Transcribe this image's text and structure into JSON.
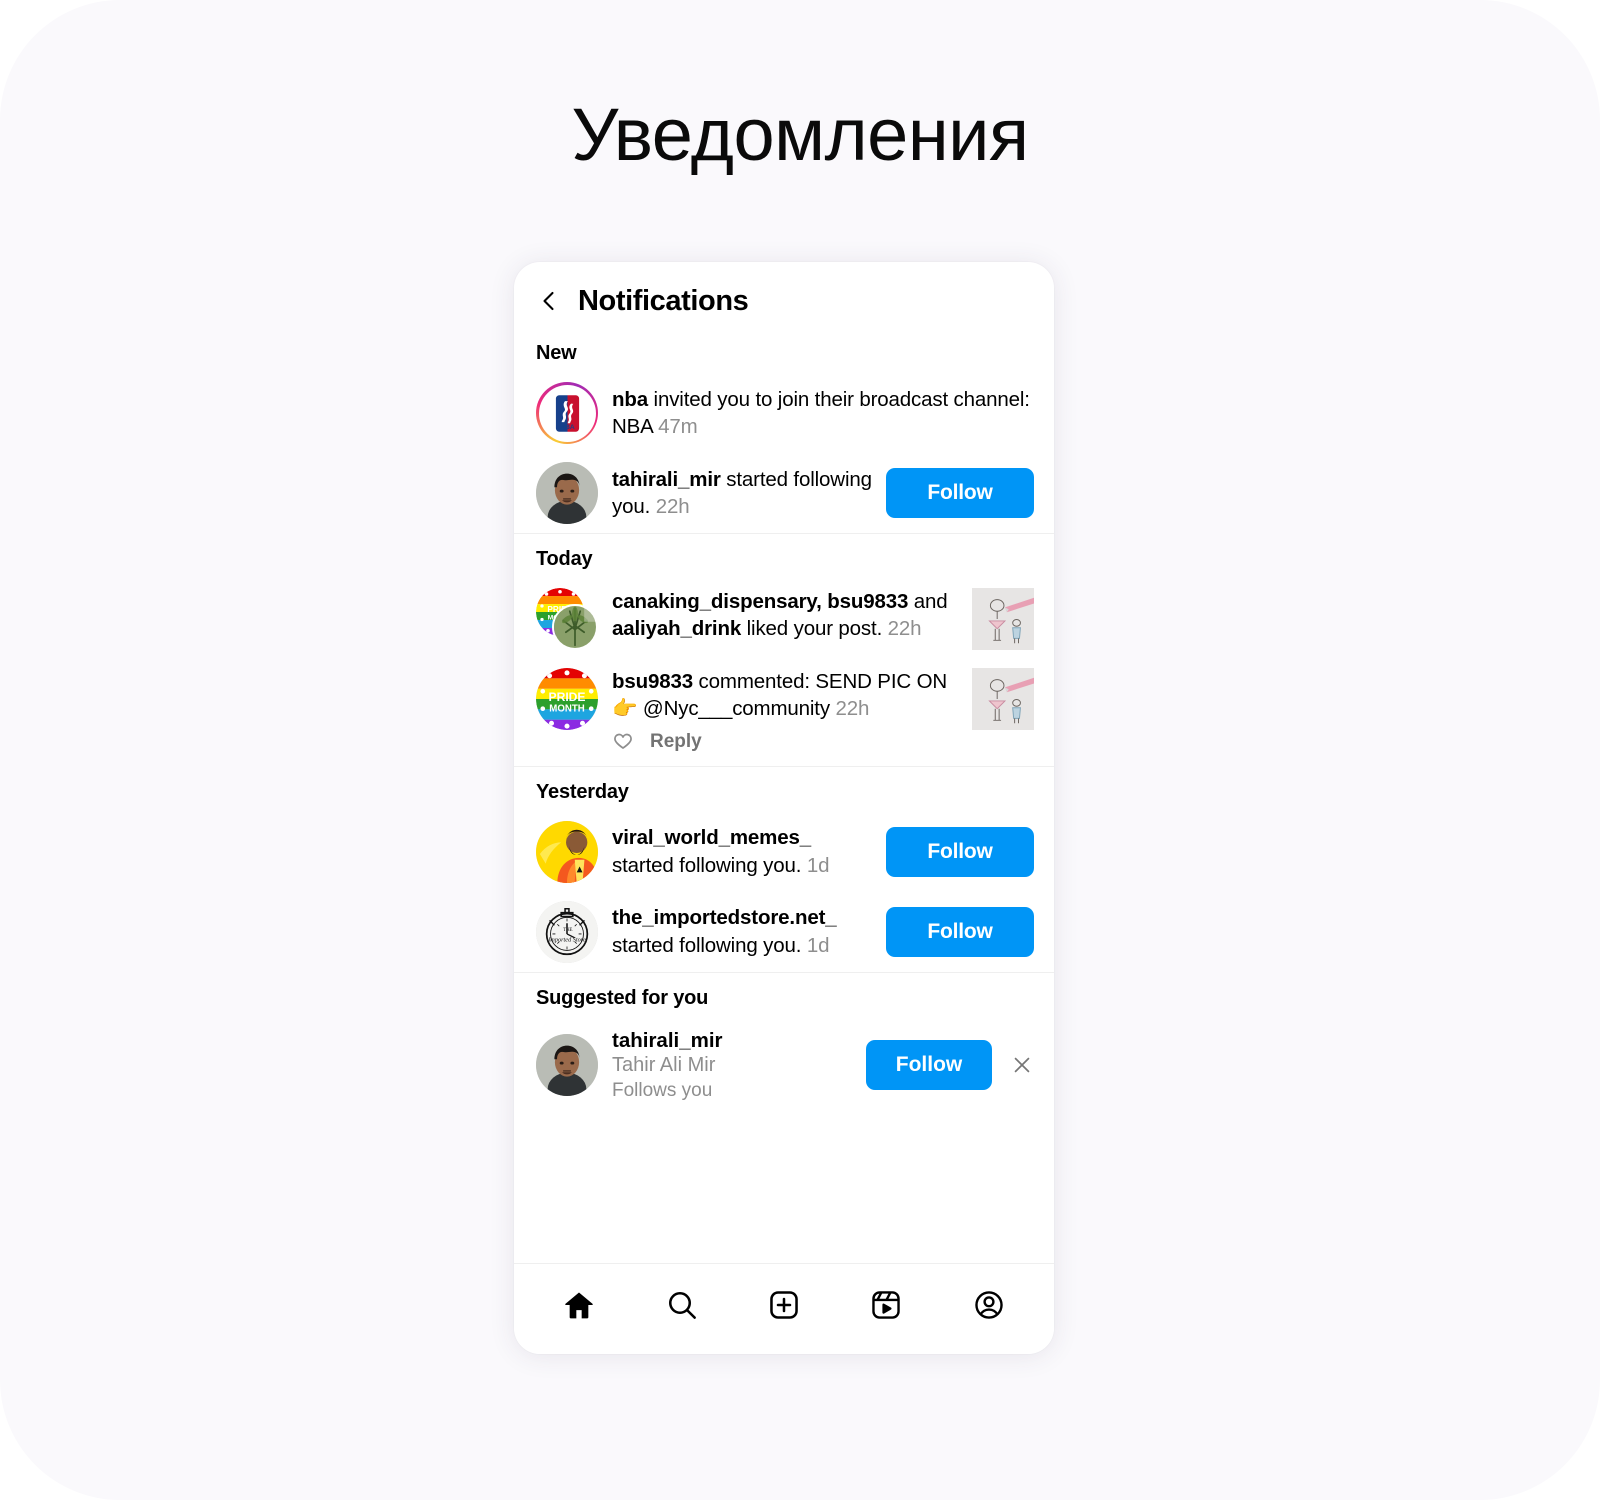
{
  "page": {
    "title": "Уведомления",
    "background_color": "#faf9fc"
  },
  "phone": {
    "header": {
      "back_icon": "chevron-left-icon",
      "title": "Notifications"
    },
    "sections": [
      {
        "id": "new",
        "title": "New",
        "items": [
          {
            "type": "broadcast-invite",
            "avatar": "nba-logo-avatar",
            "has_story_ring": true,
            "actor": "nba",
            "text": " invited you to join their broadcast channel: NBA ",
            "time": "47m"
          },
          {
            "type": "follow-request",
            "avatar": "tahirali-photo-avatar",
            "actor": "tahirali_mir",
            "text": " started following you. ",
            "time": "22h",
            "action_label": "Follow"
          }
        ]
      },
      {
        "id": "today",
        "title": "Today",
        "items": [
          {
            "type": "like",
            "avatar": "pride-plant-stacked-avatar",
            "actor": "canaking_dispensary, bsu9833",
            "text_mid": " and ",
            "actor2": "aaliyah_drink",
            "text": " liked your post. ",
            "time": "22h",
            "thumbnail": "ballerina-drawing-thumb"
          },
          {
            "type": "comment",
            "avatar": "pride-month-avatar",
            "actor": "bsu9833",
            "text": " commented: SEND PIC ON 👉 @Nyc___community ",
            "time": "22h",
            "thumbnail": "ballerina-drawing-thumb",
            "reply": {
              "like_icon": "heart-outline-icon",
              "label": "Reply"
            }
          }
        ]
      },
      {
        "id": "yesterday",
        "title": "Yesterday",
        "items": [
          {
            "type": "follow-request",
            "avatar": "viral-memes-avatar",
            "actor": "viral_world_memes_",
            "text": " started following you. ",
            "time": "1d",
            "action_label": "Follow"
          },
          {
            "type": "follow-request",
            "avatar": "imported-store-avatar",
            "actor": "the_importedstore.net_",
            "text": " started following you. ",
            "time": "1d",
            "action_label": "Follow"
          }
        ]
      },
      {
        "id": "suggested",
        "title": "Suggested for you",
        "suggestion": {
          "avatar": "tahirali-photo-avatar",
          "username": "tahirali_mir",
          "fullname": "Tahir Ali Mir",
          "meta": "Follows you",
          "action_label": "Follow",
          "dismiss_icon": "close-icon"
        }
      }
    ],
    "bottom_nav": [
      {
        "icon": "home-icon",
        "active": true
      },
      {
        "icon": "search-icon",
        "active": false
      },
      {
        "icon": "create-plus-icon",
        "active": false
      },
      {
        "icon": "reels-icon",
        "active": false
      },
      {
        "icon": "profile-icon",
        "active": false
      }
    ]
  },
  "colors": {
    "accent_blue": "#0095f6",
    "muted_gray": "#8e8e8e",
    "divider": "#efefef"
  }
}
